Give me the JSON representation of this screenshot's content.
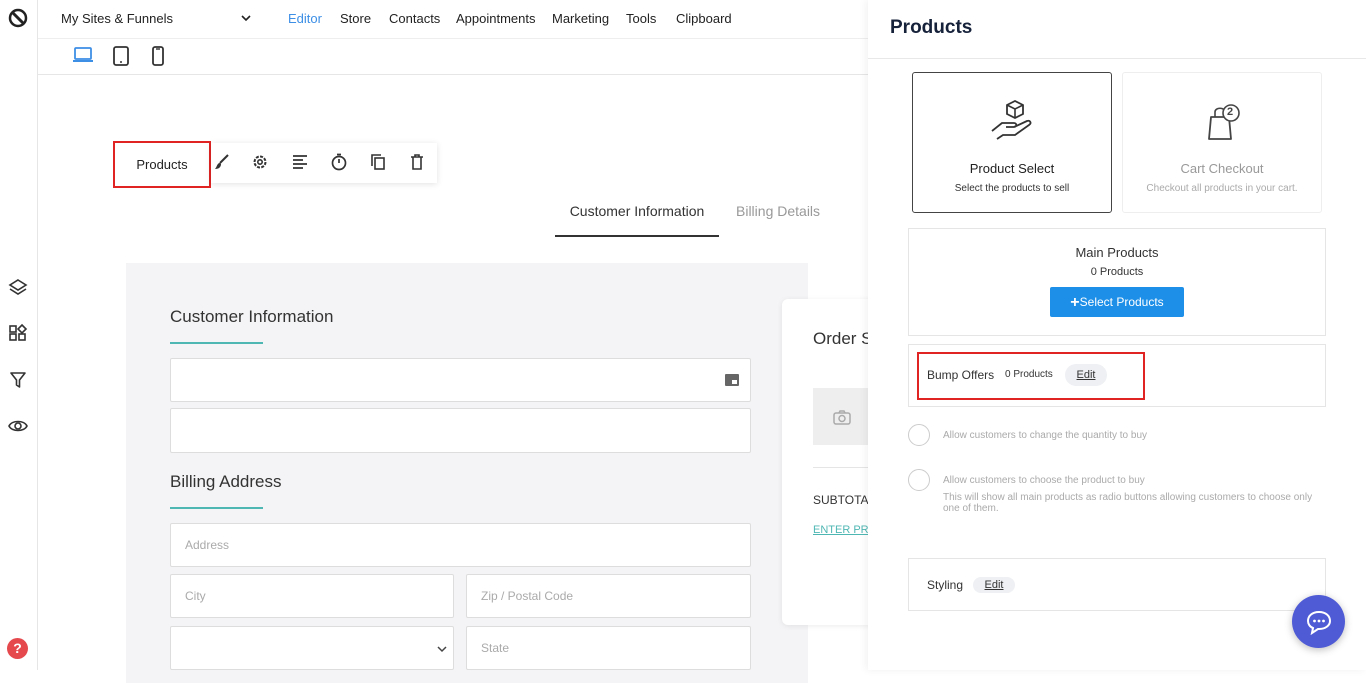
{
  "topnav": {
    "site_select": "My Sites & Funnels",
    "items": [
      "Editor",
      "Store",
      "Contacts",
      "Appointments",
      "Marketing",
      "Tools",
      "Clipboard"
    ]
  },
  "canvas": {
    "element_label": "Products",
    "tabs": {
      "customer": "Customer Information",
      "billing": "Billing Details"
    },
    "customer_heading": "Customer Information",
    "billing_heading": "Billing Address",
    "fields": {
      "address": "Address",
      "city": "City",
      "zip": "Zip / Postal Code",
      "state": "State"
    },
    "order_summary_heading": "Order S",
    "subtotal": "SUBTOTAL",
    "coupon_link": "ENTER PRO"
  },
  "panel": {
    "title": "Products",
    "option_product_select": {
      "title": "Product Select",
      "subtitle": "Select the products to sell"
    },
    "option_cart_checkout": {
      "title": "Cart Checkout",
      "subtitle": "Checkout all products in your cart.",
      "badge": "2"
    },
    "main_products": {
      "title": "Main Products",
      "count": "0 Products",
      "button": "Select Products"
    },
    "bump_offers": {
      "label": "Bump Offers",
      "count": "0 Products",
      "edit": "Edit"
    },
    "option_quantity": "Allow customers to change the quantity to buy",
    "option_choose": "Allow customers to choose the product to buy",
    "option_choose_help": "This will show all main products as radio buttons allowing customers to choose only one of them.",
    "styling": {
      "label": "Styling",
      "edit": "Edit"
    }
  },
  "colors": {
    "accent": "#3d8fe6",
    "primary_button": "#1d8fe8",
    "highlight": "#e02424",
    "teal": "#4fb7b3",
    "chat": "#4f5bd5"
  },
  "help_icon": "?"
}
